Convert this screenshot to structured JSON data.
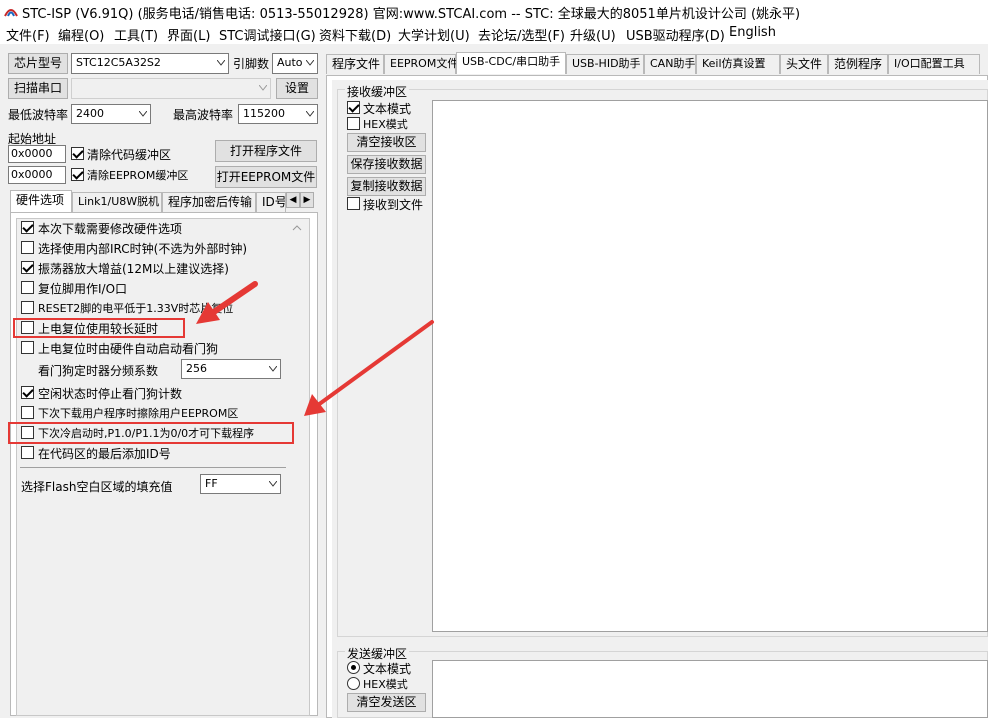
{
  "window": {
    "title": "STC-ISP (V6.91Q) (服务电话/销售电话: 0513-55012928) 官网:www.STCAI.com  -- STC: 全球最大的8051单片机设计公司 (姚永平)"
  },
  "menu": [
    "文件(F)",
    "编程(O)",
    "工具(T)",
    "界面(L)",
    "STC调试接口(G)",
    "资料下载(D)",
    "大学计划(U)",
    "去论坛/选型(F)",
    "升级(U)",
    "USB驱动程序(D)",
    "English"
  ],
  "left": {
    "chip_btn": "芯片型号",
    "chip_value": "STC12C5A32S2",
    "pin_label": "引脚数",
    "pin_value": "Auto",
    "scan_btn": "扫描串口",
    "port_value": "",
    "settings_btn": "设置",
    "min_baud_label": "最低波特率",
    "min_baud": "2400",
    "max_baud_label": "最高波特率",
    "max_baud": "115200",
    "start_addr_label": "起始地址",
    "addr1": "0x0000",
    "clear_code": "清除代码缓冲区",
    "open_prog_btn": "打开程序文件",
    "addr2": "0x0000",
    "clear_eeprom": "清除EEPROM缓冲区",
    "open_eeprom_btn": "打开EEPROM文件",
    "tabs": [
      "硬件选项",
      "Link1/U8W脱机",
      "程序加密后传输",
      "ID号"
    ],
    "options": [
      {
        "label": "本次下载需要修改硬件选项",
        "checked": true
      },
      {
        "label": "选择使用内部IRC时钟(不选为外部时钟)",
        "checked": false
      },
      {
        "label": "振荡器放大增益(12M以上建议选择)",
        "checked": true
      },
      {
        "label": "复位脚用作I/O口",
        "checked": false
      },
      {
        "label": "RESET2脚的电平低于1.33V时芯片复位",
        "checked": false
      },
      {
        "label": "上电复位使用较长延时",
        "checked": false
      },
      {
        "label": "上电复位时由硬件自动启动看门狗",
        "checked": false
      }
    ],
    "wdt_label": "看门狗定时器分频系数",
    "wdt_value": "256",
    "options2": [
      {
        "label": "空闲状态时停止看门狗计数",
        "checked": true
      },
      {
        "label": "下次下载用户程序时擦除用户EEPROM区",
        "checked": false
      },
      {
        "label": "下次冷启动时,P1.0/P1.1为0/0才可下载程序",
        "checked": false
      },
      {
        "label": "在代码区的最后添加ID号",
        "checked": false
      }
    ],
    "fill_label": "选择Flash空白区域的填充值",
    "fill_value": "FF"
  },
  "right": {
    "tabs": [
      "程序文件",
      "EEPROM文件",
      "USB-CDC/串口助手",
      "USB-HID助手",
      "CAN助手",
      "Keil仿真设置",
      "头文件",
      "范例程序",
      "I/O口配置工具"
    ],
    "active_tab": 2,
    "recv_title": "接收缓冲区",
    "recv_text_mode": "文本模式",
    "recv_hex_mode": "HEX模式",
    "recv_text_checked": true,
    "recv_hex_checked": false,
    "clear_recv": "清空接收区",
    "save_recv": "保存接收数据",
    "copy_recv": "复制接收数据",
    "recv_to_file": "接收到文件",
    "send_title": "发送缓冲区",
    "send_text_mode": "文本模式",
    "send_hex_mode": "HEX模式",
    "clear_send": "清空发送区"
  },
  "colors": {
    "highlight": "#e53935",
    "arrow": "#e53935"
  }
}
